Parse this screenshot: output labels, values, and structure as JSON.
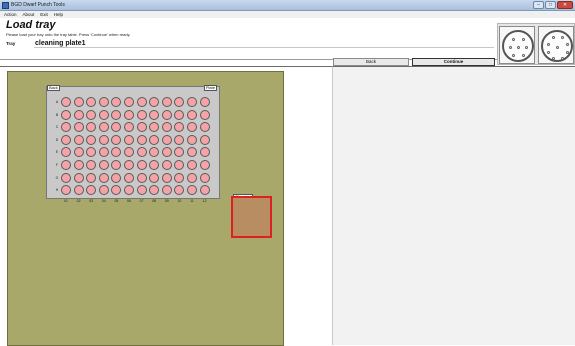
{
  "window": {
    "title": "BGD Dwarf Punch Tools",
    "controls": {
      "minimize": "–",
      "maximize": "□",
      "close": "✕"
    }
  },
  "menubar": [
    "Action",
    "About",
    "Exit",
    "Help"
  ],
  "header": {
    "heading": "Load tray",
    "instruction": "Please load your tray onto the tray table. Press 'Continue' when ready.",
    "tray_label": "Tray",
    "tray_value": "cleaning plate1"
  },
  "buttons": {
    "back": {
      "label": "Back"
    },
    "continue": {
      "label": "Continue"
    }
  },
  "plate": {
    "tabs": {
      "back": "Back",
      "flip": "Plate"
    },
    "rows": [
      "A",
      "B",
      "C",
      "D",
      "E",
      "F",
      "G",
      "H"
    ],
    "columns": [
      "01",
      "02",
      "03",
      "04",
      "05",
      "06",
      "07",
      "08",
      "09",
      "10",
      "11",
      "12"
    ],
    "well_color": "#f5a3a6"
  },
  "cleaning_station": {
    "label": "Cleaning",
    "fill_color": "#b88d62",
    "outline_color": "#e02020"
  },
  "colors": {
    "deck": "#a9a86b",
    "plate": "#c9c9c9",
    "right_panel": "#f2f2f2"
  },
  "previews": [
    {
      "name": "disc-preview-1"
    },
    {
      "name": "disc-preview-2"
    }
  ]
}
